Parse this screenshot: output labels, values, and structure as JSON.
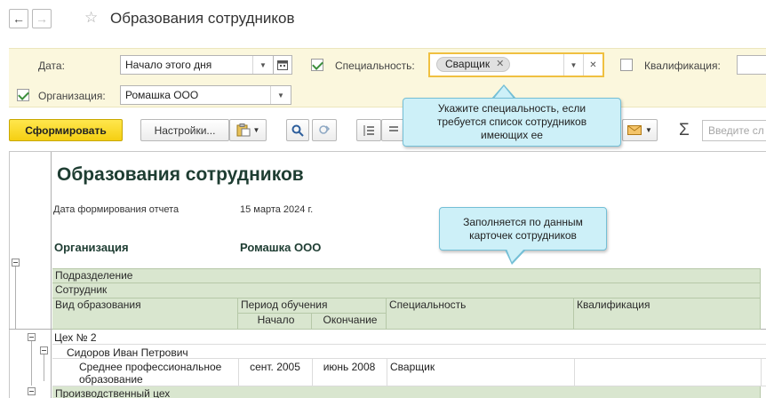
{
  "window": {
    "title": "Образования сотрудников",
    "back_icon": "←",
    "forward_icon": "→",
    "favorite_icon": "☆"
  },
  "filters": {
    "date": {
      "label": "Дата:",
      "value": "Начало этого дня"
    },
    "specialty": {
      "label": "Специальность:",
      "checked": true,
      "chip": "Сварщик"
    },
    "qualification": {
      "label": "Квалификация:",
      "checked": false
    },
    "organization": {
      "label": "Организация:",
      "checked": true,
      "value": "Ромашка ООО"
    }
  },
  "toolbar": {
    "generate": "Сформировать",
    "settings": "Настройки...",
    "search_placeholder": "Введите сл",
    "sum_icon": "Σ"
  },
  "report": {
    "title": "Образования сотрудников",
    "date_label": "Дата формирования отчета",
    "date_value": "15 марта 2024 г.",
    "org_label": "Организация",
    "org_value": "Ромашка ООО",
    "headers": {
      "department": "Подразделение",
      "employee": "Сотрудник",
      "edu_type": "Вид образования",
      "period": "Период обучения",
      "start": "Начало",
      "end": "Окончание",
      "specialty": "Специальность",
      "qualification": "Квалификация"
    },
    "rows": [
      {
        "level": "department",
        "text": "Цех № 2"
      },
      {
        "level": "employee",
        "text": "Сидоров Иван Петрович"
      },
      {
        "level": "detail",
        "edu_type_1": "Среднее профессиональное",
        "edu_type_2": "образование",
        "start": "сент. 2005",
        "end": "июнь 2008",
        "specialty": "Сварщик",
        "qualification": ""
      },
      {
        "level": "department",
        "text": "Производственный цех"
      }
    ]
  },
  "callouts": {
    "specialty_hint_1": "Укажите специальность, если",
    "specialty_hint_2": "требуется список сотрудников",
    "specialty_hint_3": "имеющих ее",
    "data_hint_1": "Заполняется по данным",
    "data_hint_2": "карточек сотрудников"
  },
  "colors": {
    "primary_button": "#f5cf12",
    "filter_panel": "#fbf7dd",
    "table_header": "#d9e6cf",
    "callout": "#cdf0f8",
    "highlight_border": "#f0c040"
  }
}
